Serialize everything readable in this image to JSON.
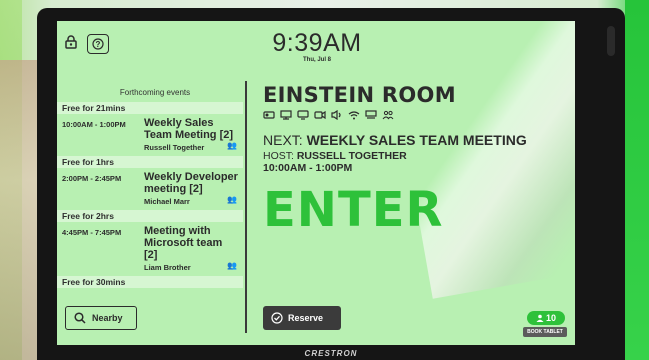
{
  "header": {
    "time": "9:39AM",
    "date": "Thu, Jul 8"
  },
  "schedule": {
    "title": "Forthcoming events",
    "items": [
      {
        "type": "free",
        "label": "Free for 21mins"
      },
      {
        "type": "event",
        "time": "10:00AM - 1:00PM",
        "title": "Weekly Sales Team Meeting [2]",
        "host": "Russell Together"
      },
      {
        "type": "free",
        "label": "Free for 1hrs"
      },
      {
        "type": "event",
        "time": "2:00PM - 2:45PM",
        "title": "Weekly Developer meeting [2]",
        "host": "Michael Marr"
      },
      {
        "type": "free",
        "label": "Free for 2hrs"
      },
      {
        "type": "event",
        "time": "4:45PM - 7:45PM",
        "title": "Meeting with Microsoft team [2]",
        "host": "Liam Brother"
      },
      {
        "type": "free",
        "label": "Free for 30mins"
      }
    ]
  },
  "buttons": {
    "nearby": "Nearby",
    "reserve": "Reserve"
  },
  "room": {
    "name": "EINSTEIN ROOM",
    "next_prefix": "NEXT:",
    "next_title": "WEEKLY SALES TEAM MEETING",
    "host_prefix": "HOST:",
    "host_name": "RUSSELL TOGETHER",
    "time": "10:00AM - 1:00PM",
    "action": "ENTER"
  },
  "capacity": "10",
  "book_tablet": "BOOK TABLET",
  "brand": "CRESTRON",
  "colors": {
    "screen_bg": "#b8f0b2",
    "accent_green": "#2ec13a",
    "dark_text": "#2b2b2b"
  }
}
